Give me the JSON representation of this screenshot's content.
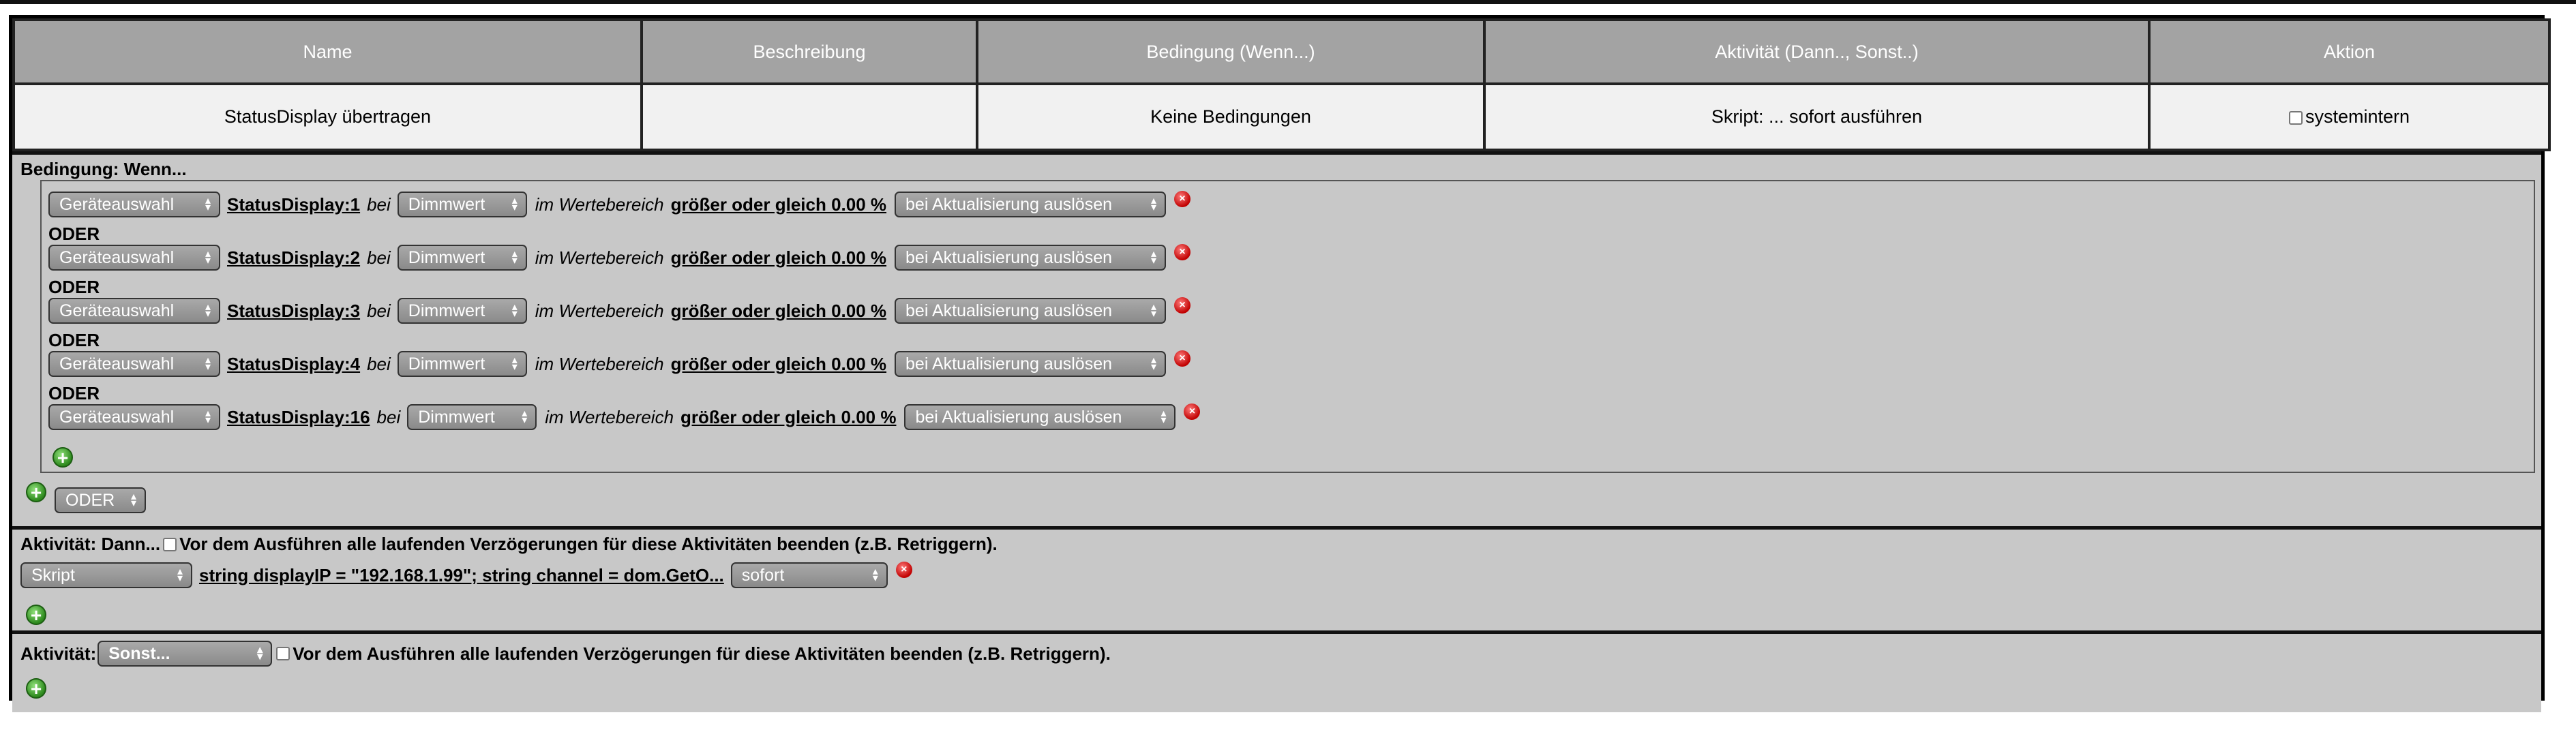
{
  "header": {
    "columns": [
      "Name",
      "Beschreibung",
      "Bedingung (Wenn...)",
      "Aktivität (Dann.., Sonst..)",
      "Aktion"
    ],
    "row": {
      "name": "StatusDisplay übertragen",
      "beschreibung": "",
      "bedingung": "Keine Bedingungen",
      "aktivitaet": "Skript: ... sofort ausführen",
      "aktion_label": "systemintern"
    }
  },
  "condition": {
    "title": "Bedingung: Wenn...",
    "or_label": "ODER",
    "rows": [
      {
        "device_select": "Geräteauswahl",
        "device": "StatusDisplay:1",
        "bei": "bei",
        "value_select": "Dimmwert",
        "range_text": "im Wertebereich",
        "condition": "größer oder gleich 0.00 %",
        "trigger_select": "bei Aktualisierung auslösen"
      },
      {
        "device_select": "Geräteauswahl",
        "device": "StatusDisplay:2",
        "bei": "bei",
        "value_select": "Dimmwert",
        "range_text": "im Wertebereich",
        "condition": "größer oder gleich 0.00 %",
        "trigger_select": "bei Aktualisierung auslösen"
      },
      {
        "device_select": "Geräteauswahl",
        "device": "StatusDisplay:3",
        "bei": "bei",
        "value_select": "Dimmwert",
        "range_text": "im Wertebereich",
        "condition": "größer oder gleich 0.00 %",
        "trigger_select": "bei Aktualisierung auslösen"
      },
      {
        "device_select": "Geräteauswahl",
        "device": "StatusDisplay:4",
        "bei": "bei",
        "value_select": "Dimmwert",
        "range_text": "im Wertebereich",
        "condition": "größer oder gleich 0.00 %",
        "trigger_select": "bei Aktualisierung auslösen"
      },
      {
        "device_select": "Geräteauswahl",
        "device": "StatusDisplay:16",
        "bei": "bei",
        "value_select": "Dimmwert",
        "range_text": "im Wertebereich",
        "condition": "größer oder gleich 0.00 %",
        "trigger_select": "bei Aktualisierung auslösen"
      }
    ],
    "combiner_select": "ODER"
  },
  "then": {
    "title": "Aktivität: Dann...",
    "retrigger_label": "Vor dem Ausführen alle laufenden Verzögerungen für diese Aktivitäten beenden (z.B. Retriggern).",
    "type_select": "Skript",
    "script_text": "string displayIP = \"192.168.1.99\"; string channel = dom.GetO...",
    "timing_select": "sofort"
  },
  "else": {
    "title": "Aktivität:",
    "type_select": "Sonst...",
    "retrigger_label": "Vor dem Ausführen alle laufenden Verzögerungen für diese Aktivitäten beenden (z.B. Retriggern)."
  },
  "icons": {
    "delete": "delete-icon",
    "add": "add-icon",
    "arrows": "select-arrows-icon"
  }
}
